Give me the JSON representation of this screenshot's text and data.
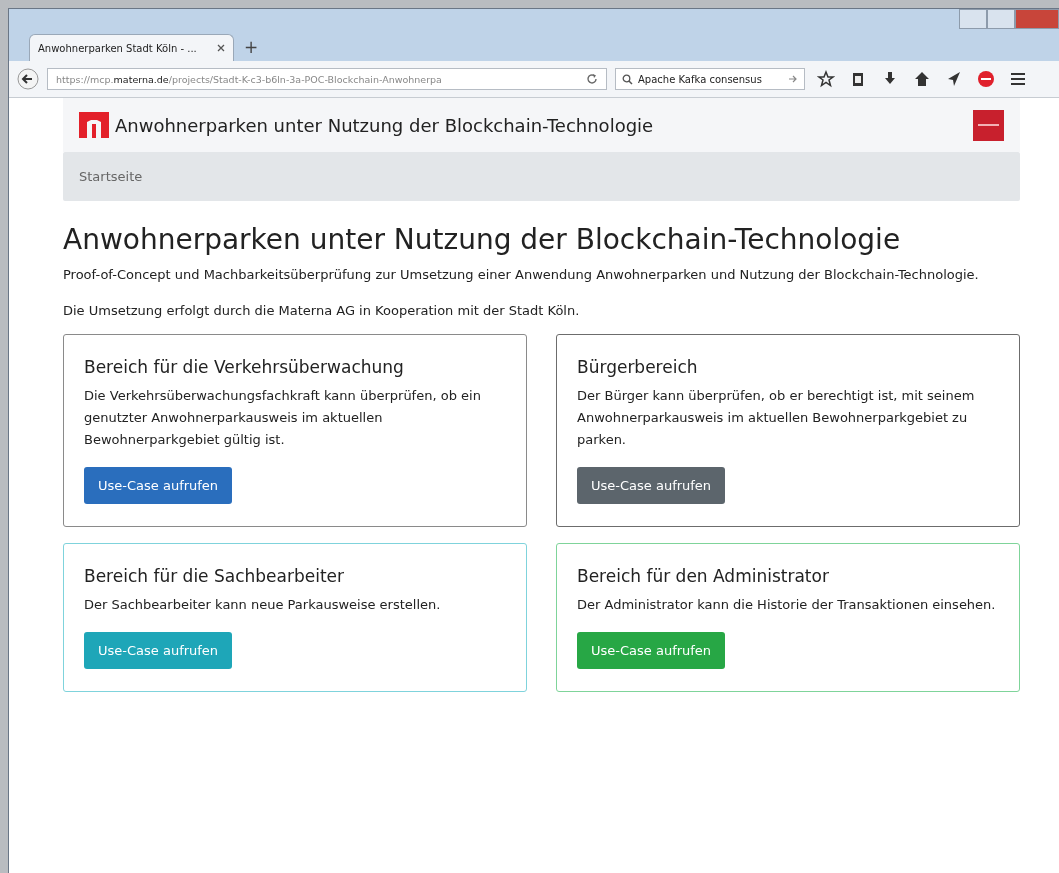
{
  "browser": {
    "tab_title": "Anwohnerparken Stadt Köln - ...",
    "new_tab": "+",
    "url_host": "https://mcp.",
    "url_domain": "materna.de",
    "url_path": "/projects/Stadt-K-c3-b6ln-3a-POC-Blockchain-Anwohnerpa",
    "search": "Apache Kafka consensus"
  },
  "header": {
    "title": "Anwohnerparken unter Nutzung der Blockchain-Technologie"
  },
  "nav": {
    "items": [
      {
        "label": "Startseite"
      }
    ]
  },
  "page": {
    "heading": "Anwohnerparken unter Nutzung der Blockchain-Technologie",
    "intro": "Proof-of-Concept und Machbarkeitsüberprüfung zur Umsetzung einer Anwendung Anwohnerparken und Nutzung der Blockchain-Technologie.",
    "note": "Die Umsetzung erfolgt durch die Materna AG in Kooperation mit der Stadt Köln."
  },
  "cards": [
    {
      "kind": "primary",
      "title": "Bereich für die Verkehrsüberwachung",
      "text": "Die Verkehrsüberwachungsfachkraft kann überprüfen, ob ein genutzter Anwohnerparkausweis im aktuellen Bewohnerparkgebiet gültig ist.",
      "button": "Use-Case aufrufen"
    },
    {
      "kind": "secondary",
      "title": "Bürgerbereich",
      "text": "Der Bürger kann überprüfen, ob er berechtigt ist, mit seinem Anwohnerparkausweis im aktuellen Bewohnerparkgebiet zu parken.",
      "button": "Use-Case aufrufen"
    },
    {
      "kind": "info",
      "title": "Bereich für die Sachbearbeiter",
      "text": "Der Sachbearbeiter kann neue Parkausweise erstellen.",
      "button": "Use-Case aufrufen"
    },
    {
      "kind": "success",
      "title": "Bereich für den Administrator",
      "text": "Der Administrator kann die Historie der Transaktionen einsehen.",
      "button": "Use-Case aufrufen"
    }
  ]
}
